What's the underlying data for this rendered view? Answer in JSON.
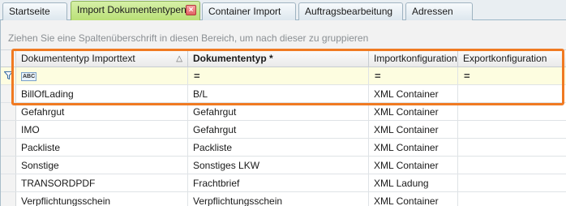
{
  "tabs": [
    {
      "label": "Startseite"
    },
    {
      "label": "Import Dokumententypen"
    },
    {
      "label": "Container Import"
    },
    {
      "label": "Auftragsbearbeitung"
    },
    {
      "label": "Adressen"
    }
  ],
  "group_panel": {
    "hint": "Ziehen Sie eine Spaltenüberschrift in diesen Bereich, um nach dieser zu gruppieren"
  },
  "grid": {
    "columns": [
      {
        "label": "Dokumententyp Importtext",
        "sort_icon": "△"
      },
      {
        "label": "Dokumententyp *"
      },
      {
        "label": "Importkonfiguration"
      },
      {
        "label": "Exportkonfiguration"
      }
    ],
    "filter_row": {
      "text_filter_icon": "abc-icon",
      "equals_symbol": "="
    },
    "rows": [
      [
        "BillOfLading",
        "B/L",
        "XML Container",
        ""
      ],
      [
        "Gefahrgut",
        "Gefahrgut",
        "XML Container",
        ""
      ],
      [
        "IMO",
        "Gefahrgut",
        "XML Container",
        ""
      ],
      [
        "Packliste",
        "Packliste",
        "XML Container",
        ""
      ],
      [
        "Sonstige",
        "Sonstiges LKW",
        "XML Container",
        ""
      ],
      [
        "TRANSORDPDF",
        "Frachtbrief",
        "XML Ladung",
        ""
      ],
      [
        "Verpflichtungsschein",
        "Verpflichtungsschein",
        "XML Container",
        ""
      ]
    ]
  },
  "colors": {
    "active_tab": "#b8df74",
    "highlight": "#f07a22",
    "filter_row": "#fdfde0"
  }
}
